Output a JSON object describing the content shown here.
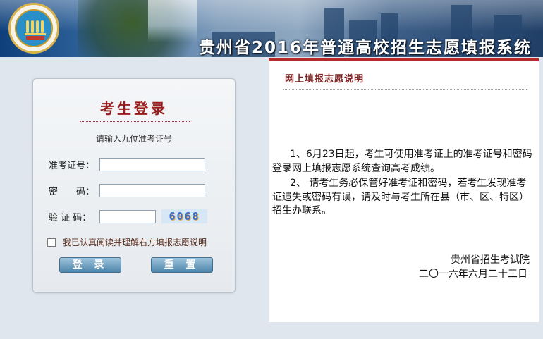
{
  "header": {
    "title": "贵州省2016年普通高校招生志愿填报系统",
    "logo_icon": "provincial-exam-logo"
  },
  "login": {
    "title": "考生登录",
    "hint": "请输入九位准考证号",
    "ticket_label": "准考证号：",
    "password_label": "密　　码：",
    "captcha_label": "验 证 码：",
    "ticket_value": "",
    "password_value": "",
    "captcha_value": "",
    "captcha_image_text": "6068",
    "agree_label": "我已认真阅读并理解右方填报志愿说明",
    "agree_checked": false,
    "login_button": "登 录",
    "reset_button": "重 置"
  },
  "notice": {
    "title": "网上填报志愿说明",
    "paragraphs": [
      "1、6月23日起，考生可使用准考证上的准考证号和密码登录网上填报志愿系统查询高考成绩。",
      "2、 请考生务必保管好准考证和密码，若考生发现准考证遗失或密码有误，请及时与考生所在县（市、区、特区）招生办联系。"
    ],
    "signature_org": "贵州省招生考试院",
    "signature_date": "二〇一六年六月二十三日"
  },
  "colors": {
    "accent_red": "#9b1c1c",
    "button_blue": "#4d85ab",
    "page_bg": "#dfe6ee"
  }
}
